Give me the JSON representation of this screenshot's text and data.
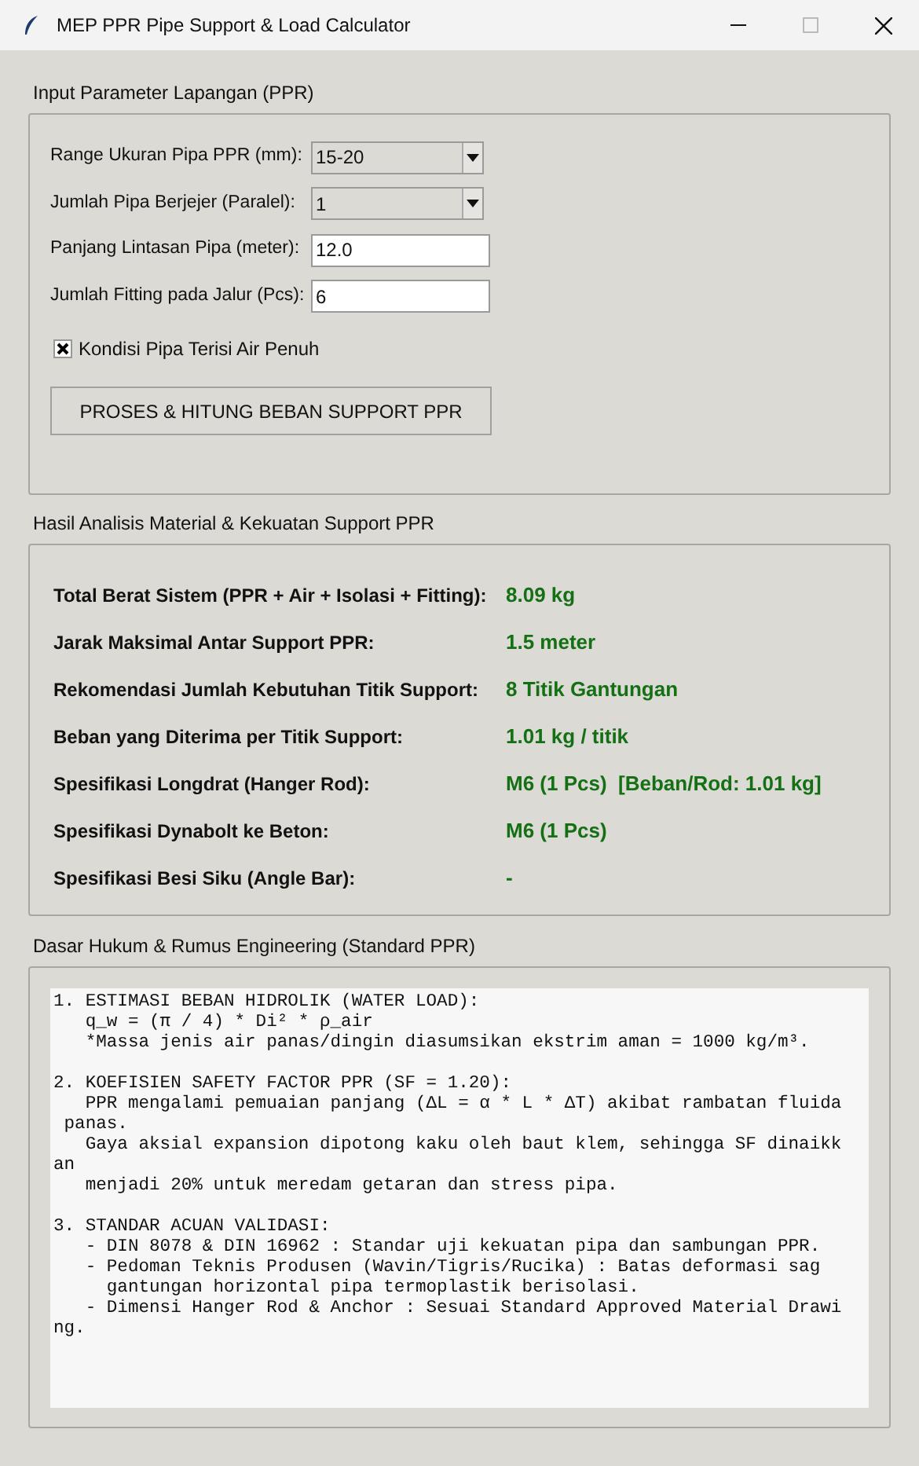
{
  "window": {
    "title": "MEP PPR Pipe Support & Load Calculator"
  },
  "input_section": {
    "title": "Input Parameter Lapangan (PPR)",
    "fields": [
      {
        "kind": "dropdown",
        "label": "Range Ukuran Pipa PPR (mm):",
        "value": "15-20"
      },
      {
        "kind": "dropdown",
        "label": "Jumlah Pipa Berjejer (Paralel):",
        "value": "1"
      },
      {
        "kind": "entry",
        "label": "Panjang Lintasan Pipa (meter):",
        "value": "12.0"
      },
      {
        "kind": "entry",
        "label": "Jumlah Fitting pada Jalur (Pcs):",
        "value": "6"
      }
    ],
    "checkbox": {
      "label": "Kondisi Pipa Terisi Air Penuh",
      "checked": true
    },
    "button": "PROSES & HITUNG BEBAN SUPPORT PPR"
  },
  "results_section": {
    "title": "Hasil Analisis Material & Kekuatan Support PPR",
    "rows": [
      {
        "label": "Total Berat Sistem (PPR + Air + Isolasi + Fitting):",
        "value": "8.09 kg"
      },
      {
        "label": "Jarak Maksimal Antar Support PPR:",
        "value": "1.5 meter"
      },
      {
        "label": "Rekomendasi Jumlah Kebutuhan Titik Support:",
        "value": "8 Titik Gantungan"
      },
      {
        "label": "Beban yang Diterima per Titik Support:",
        "value": "1.01 kg / titik"
      },
      {
        "label": "Spesifikasi Longdrat (Hanger Rod):",
        "value": "M6 (1 Pcs)  [Beban/Rod: 1.01 kg]"
      },
      {
        "label": "Spesifikasi Dynabolt ke Beton:",
        "value": "M6 (1 Pcs)"
      },
      {
        "label": "Spesifikasi Besi Siku (Angle Bar):",
        "value": "-"
      }
    ]
  },
  "reference_section": {
    "title": "Dasar Hukum & Rumus Engineering (Standard PPR)",
    "paragraphs": [
      [
        "1. ESTIMASI BEBAN HIDROLIK (WATER LOAD):",
        "   q_w = (π / 4) * Di² * ρ_air",
        "   *Massa jenis air panas/dingin diasumsikan ekstrim aman = 1000 kg/m³."
      ],
      [
        "2. KOEFISIEN SAFETY FACTOR PPR (SF = 1.20):",
        "   PPR mengalami pemuaian panjang (ΔL = α * L * ΔT) akibat rambatan fluida",
        " panas.",
        "   Gaya aksial expansion dipotong kaku oleh baut klem, sehingga SF dinaikk",
        "an",
        "   menjadi 20% untuk meredam getaran dan stress pipa."
      ],
      [
        "3. STANDAR ACUAN VALIDASI:",
        "   - DIN 8078 & DIN 16962 : Standar uji kekuatan pipa dan sambungan PPR.",
        "   - Pedoman Teknis Produsen (Wavin/Tigris/Rucika) : Batas deformasi sag",
        "     gantungan horizontal pipa termoplastik berisolasi.",
        "   - Dimensi Hanger Rod & Anchor : Sesuai Standard Approved Material Drawi",
        "ng."
      ]
    ]
  }
}
